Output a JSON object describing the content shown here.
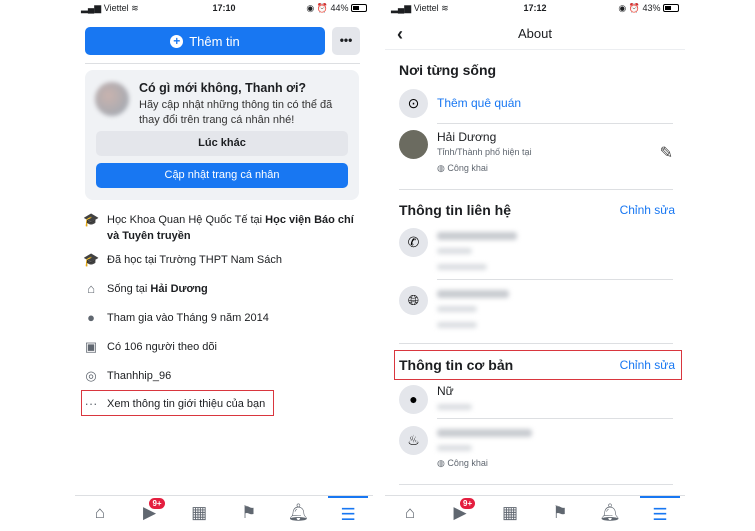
{
  "left": {
    "status": {
      "carrier": "Viettel",
      "time": "17:10",
      "battery": "44%"
    },
    "add_story_label": "Thêm tin",
    "more_label": "•••",
    "prompt": {
      "title": "Có gì mới không, Thanh ơi?",
      "subtitle": "Hãy cập nhật những thông tin có thể đã thay đổi trên trang cá nhân nhé!",
      "later_label": "Lúc khác",
      "update_label": "Cập nhật trang cá nhân"
    },
    "info": [
      {
        "icon": "graduation-cap-icon",
        "pre": "Học Khoa Quan Hệ Quốc Tế tại ",
        "bold": "Học viện Báo chí và Tuyên truyền"
      },
      {
        "icon": "graduation-cap-icon",
        "pre": "Đã học tại Trường THPT Nam Sách",
        "bold": ""
      },
      {
        "icon": "home-icon",
        "pre": "Sống tại ",
        "bold": "Hải Dương"
      },
      {
        "icon": "clock-icon",
        "pre": "Tham gia vào Tháng 9 năm 2014",
        "bold": ""
      },
      {
        "icon": "followers-icon",
        "pre": "Có 106 người theo dõi",
        "bold": ""
      },
      {
        "icon": "instagram-icon",
        "pre": "Thanhhip_96",
        "bold": ""
      }
    ],
    "see_about": "Xem thông tin giới thiệu của bạn",
    "nav_badge": "9+"
  },
  "right": {
    "status": {
      "carrier": "Viettel",
      "time": "17:12",
      "battery": "43%"
    },
    "title": "About",
    "places": {
      "heading": "Nơi từng sống",
      "add_hometown": "Thêm quê quán",
      "city": "Hải Dương",
      "city_label": "Tỉnh/Thành phố hiện tại",
      "privacy": "Công khai"
    },
    "contact": {
      "heading": "Thông tin liên hệ",
      "edit": "Chỉnh sửa"
    },
    "basic": {
      "heading": "Thông tin cơ bản",
      "edit": "Chỉnh sửa",
      "gender": "Nữ",
      "birthday_privacy": "Công khai"
    },
    "nav_badge": "9+"
  },
  "colors": {
    "accent": "#1877f2",
    "highlight": "#d9363e",
    "badge": "#e41e3f"
  }
}
